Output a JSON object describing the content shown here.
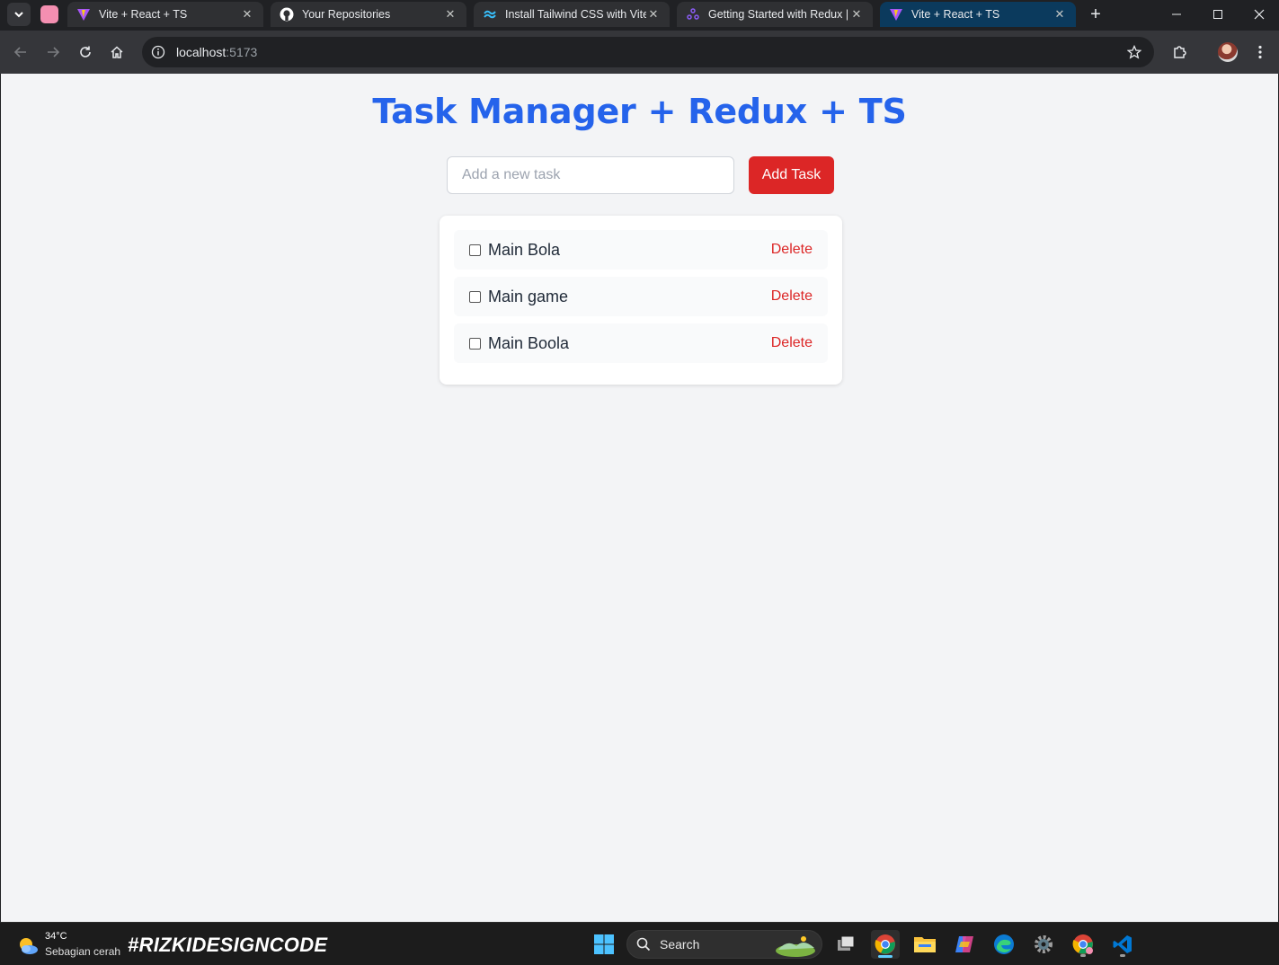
{
  "browser": {
    "tabs": [
      {
        "title": "Vite + React + TS",
        "favicon": "vite-icon",
        "active": false
      },
      {
        "title": "Your Repositories",
        "favicon": "github-icon",
        "active": false
      },
      {
        "title": "Install Tailwind CSS with Vite",
        "favicon": "tailwind-icon",
        "active": false
      },
      {
        "title": "Getting Started with Redux | R",
        "favicon": "redux-icon",
        "active": false
      },
      {
        "title": "Vite + React + TS",
        "favicon": "vite-icon",
        "active": true
      }
    ],
    "address": {
      "host": "localhost",
      "port": ":5173"
    }
  },
  "app": {
    "title": "Task Manager + Redux + TS",
    "input_placeholder": "Add a new task",
    "add_button_label": "Add Task",
    "tasks": [
      {
        "label": "Main Bola",
        "completed": false,
        "delete_label": "Delete"
      },
      {
        "label": "Main game",
        "completed": false,
        "delete_label": "Delete"
      },
      {
        "label": "Main Boola",
        "completed": false,
        "delete_label": "Delete"
      }
    ]
  },
  "taskbar": {
    "weather": {
      "temp": "34°C",
      "condition": "Sebagian cerah"
    },
    "brand_text": "#RIZKIDESIGNCODE",
    "search_label": "Search"
  },
  "colors": {
    "title": "#2563eb",
    "danger": "#dc2626",
    "page_bg": "#f3f4f6",
    "active_tab": "#0b3a5d"
  }
}
